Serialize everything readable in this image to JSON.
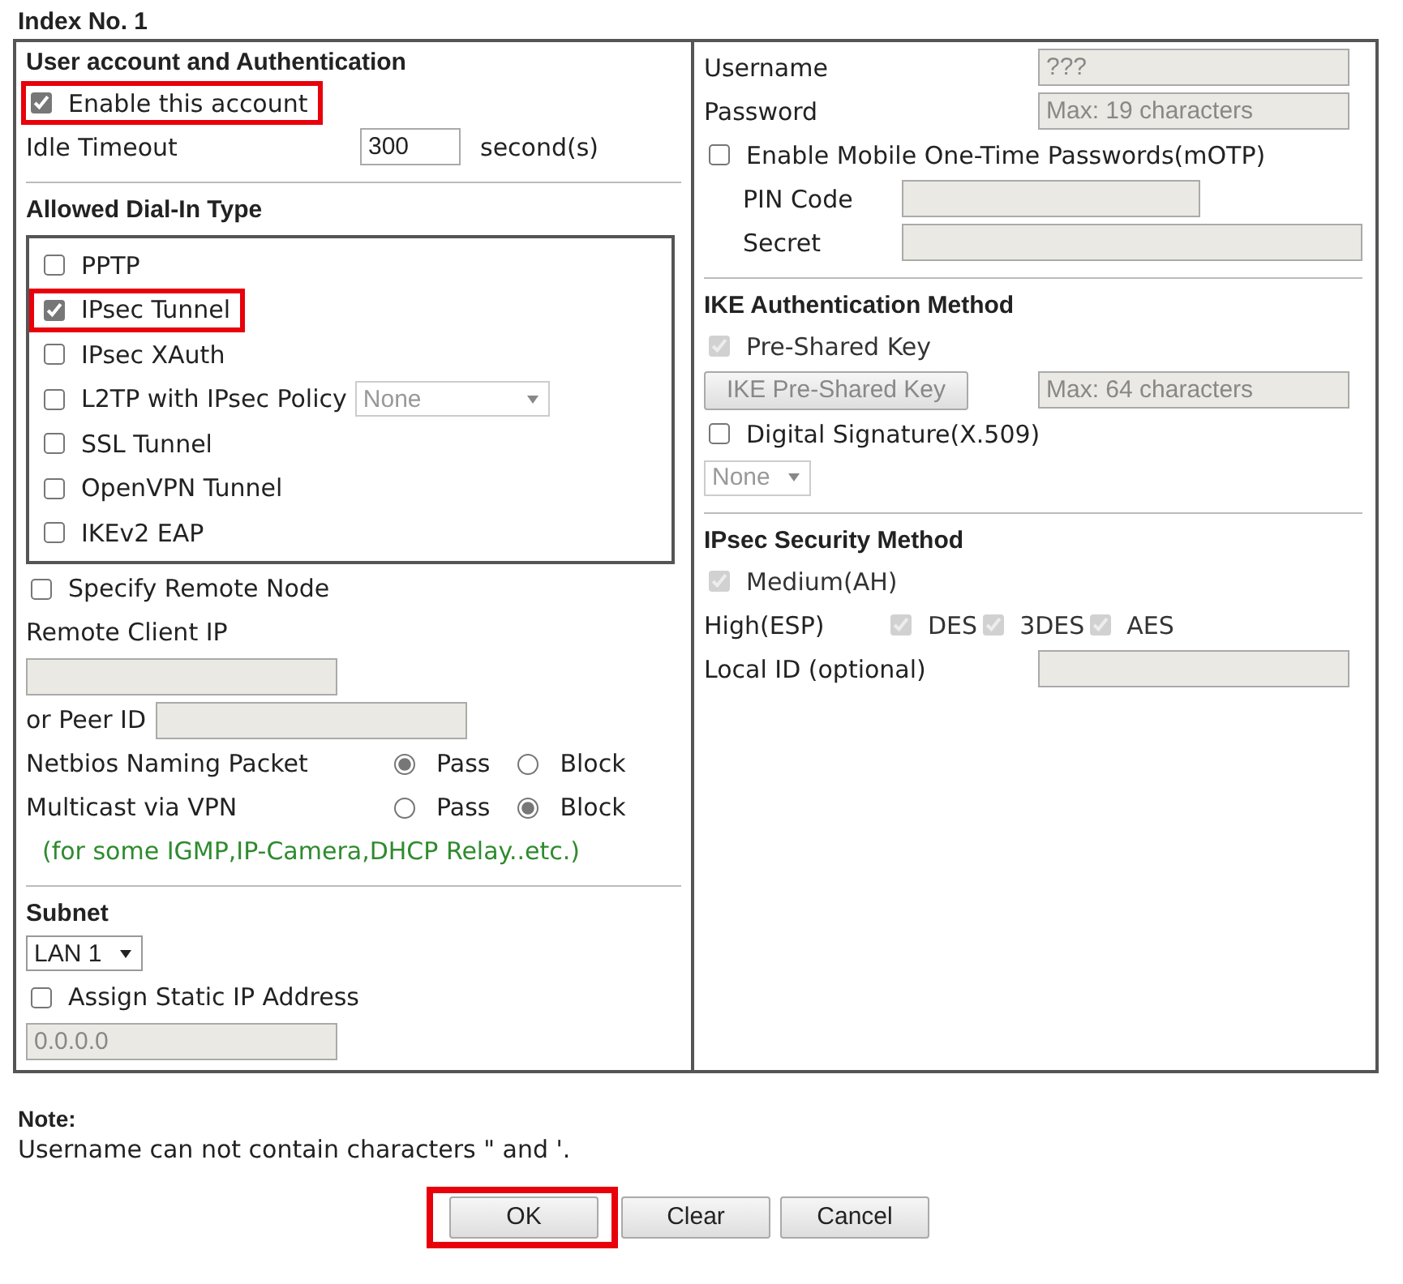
{
  "title": "Index No. 1",
  "left": {
    "account": {
      "heading": "User account and Authentication",
      "enable": {
        "label": "Enable this account",
        "checked": true,
        "highlighted": true
      },
      "idle_timeout": {
        "label": "Idle Timeout",
        "value": "300",
        "unit": "second(s)"
      }
    },
    "dial_in": {
      "heading": "Allowed Dial-In Type",
      "options": [
        {
          "label": "PPTP",
          "checked": false,
          "highlighted": false
        },
        {
          "label": "IPsec Tunnel",
          "checked": true,
          "highlighted": true
        },
        {
          "label": "IPsec XAuth",
          "checked": false,
          "highlighted": false
        },
        {
          "label": "L2TP with IPsec Policy",
          "checked": false,
          "highlighted": false,
          "select": "None"
        },
        {
          "label": "SSL Tunnel",
          "checked": false,
          "highlighted": false
        },
        {
          "label": "OpenVPN Tunnel",
          "checked": false,
          "highlighted": false
        },
        {
          "label": "IKEv2 EAP",
          "checked": false,
          "highlighted": false
        }
      ]
    },
    "remote": {
      "specify": {
        "label": "Specify Remote Node",
        "checked": false
      },
      "client_ip_label": "Remote Client IP",
      "peer_id_label": "or Peer ID"
    },
    "radio_rows": [
      {
        "label": "Netbios Naming Packet",
        "options": [
          {
            "label": "Pass",
            "selected": true
          },
          {
            "label": "Block",
            "selected": false
          }
        ]
      },
      {
        "label": "Multicast via VPN",
        "options": [
          {
            "label": "Pass",
            "selected": false
          },
          {
            "label": "Block",
            "selected": true
          }
        ]
      }
    ],
    "multicast_hint": "(for some IGMP,IP-Camera,DHCP Relay..etc.)",
    "subnet": {
      "heading": "Subnet",
      "select": "LAN 1",
      "assign_static": {
        "label": "Assign Static IP Address",
        "checked": false
      },
      "ip_value": "0.0.0.0"
    }
  },
  "right": {
    "username": {
      "label": "Username",
      "value": "???"
    },
    "password": {
      "label": "Password",
      "placeholder": "Max: 19 characters"
    },
    "motp": {
      "label": "Enable Mobile One-Time Passwords(mOTP)",
      "checked": false,
      "pin_label": "PIN Code",
      "secret_label": "Secret"
    },
    "ike": {
      "heading": "IKE Authentication Method",
      "pre_shared": {
        "label": "Pre-Shared Key",
        "checked": true,
        "disabled": true
      },
      "key_button": "IKE Pre-Shared Key",
      "key_placeholder": "Max: 64 characters",
      "digital_signature": {
        "label": "Digital Signature(X.509)",
        "checked": false,
        "disabled": false
      },
      "signature_select": "None"
    },
    "ipsec": {
      "heading": "IPsec Security Method",
      "medium": {
        "label": "Medium(AH)",
        "checked": true,
        "disabled": true
      },
      "high_label": "High(ESP)",
      "ciphers": [
        {
          "label": "DES",
          "checked": true,
          "disabled": true
        },
        {
          "label": "3DES",
          "checked": true,
          "disabled": true
        },
        {
          "label": "AES",
          "checked": true,
          "disabled": true
        }
      ],
      "local_id_label": "Local ID (optional)"
    }
  },
  "note": {
    "heading": "Note:",
    "text": "Username can not contain characters \" and '."
  },
  "buttons": [
    {
      "label": "OK",
      "highlighted": true
    },
    {
      "label": "Clear",
      "highlighted": false
    },
    {
      "label": "Cancel",
      "highlighted": false
    }
  ]
}
